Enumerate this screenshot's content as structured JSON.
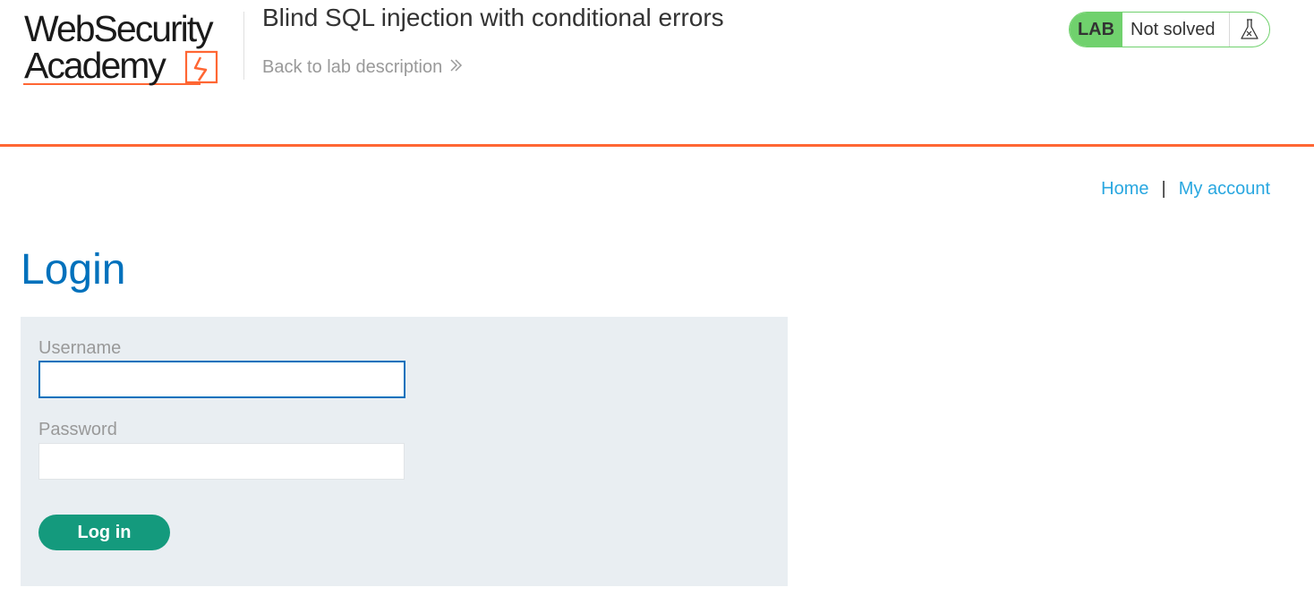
{
  "header": {
    "logo": {
      "line1": "WebSecurity",
      "line2": "Academy"
    },
    "lab_title": "Blind SQL injection with conditional errors",
    "back_link": "Back to lab description",
    "back_icon": "double-chevron-right-icon",
    "status": {
      "tag": "LAB",
      "state": "Not solved",
      "icon": "flask-icon",
      "color": "#70d16d"
    },
    "accent_color": "#ff6633"
  },
  "nav": {
    "home": "Home",
    "separator": "|",
    "my_account": "My account"
  },
  "login": {
    "heading": "Login",
    "username_label": "Username",
    "username_value": "",
    "password_label": "Password",
    "password_value": "",
    "submit_label": "Log in",
    "button_color": "#149a7d"
  }
}
